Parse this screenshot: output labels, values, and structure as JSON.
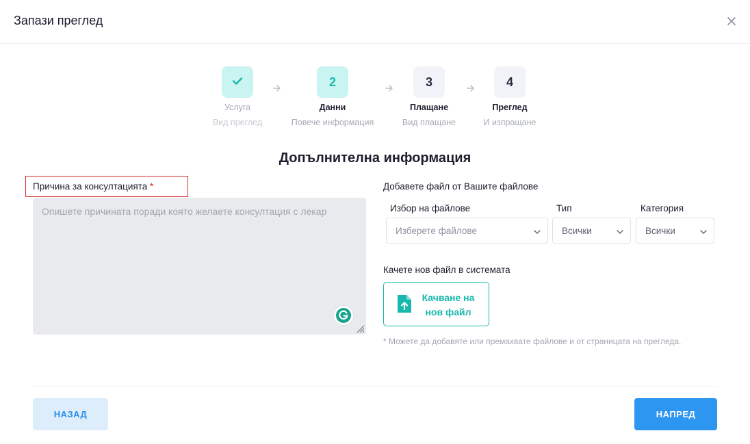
{
  "modal": {
    "title": "Запази преглед",
    "close_icon": "close-icon"
  },
  "stepper": {
    "steps": [
      {
        "number": "",
        "icon": "check-icon",
        "title": "Услуга",
        "subtitle": "Вид преглед",
        "state": "done"
      },
      {
        "number": "2",
        "title": "Данни",
        "subtitle": "Повече информация",
        "state": "active"
      },
      {
        "number": "3",
        "title": "Плащане",
        "subtitle": "Вид плащане",
        "state": "todo"
      },
      {
        "number": "4",
        "title": "Преглед",
        "subtitle": "И изпращане",
        "state": "todo"
      }
    ]
  },
  "section": {
    "title": "Допълнителна информация"
  },
  "reason": {
    "label": "Причина за консултацията",
    "required_mark": "*",
    "value": "",
    "placeholder": "Опишете причината поради която желаете консултация с лекар"
  },
  "files": {
    "title": "Добавете файл от Вашите файлове",
    "choose": {
      "label": "Избор на файлове",
      "placeholder": "Изберете файлове"
    },
    "type": {
      "label": "Тип",
      "value": "Всички"
    },
    "category": {
      "label": "Категория",
      "value": "Всички"
    },
    "upload_title": "Качете нов файл в системата",
    "upload_button": "Качване на нов файл",
    "note": "* Можете да добавяте или премахвате файлове и от страницата на прегледа."
  },
  "footer": {
    "back_label": "НАЗАД",
    "next_label": "НАПРЕД"
  },
  "colors": {
    "accent": "#18b8ad",
    "primary": "#2d96f1",
    "required": "#e0262b",
    "highlight_border": "#d62b2b"
  }
}
